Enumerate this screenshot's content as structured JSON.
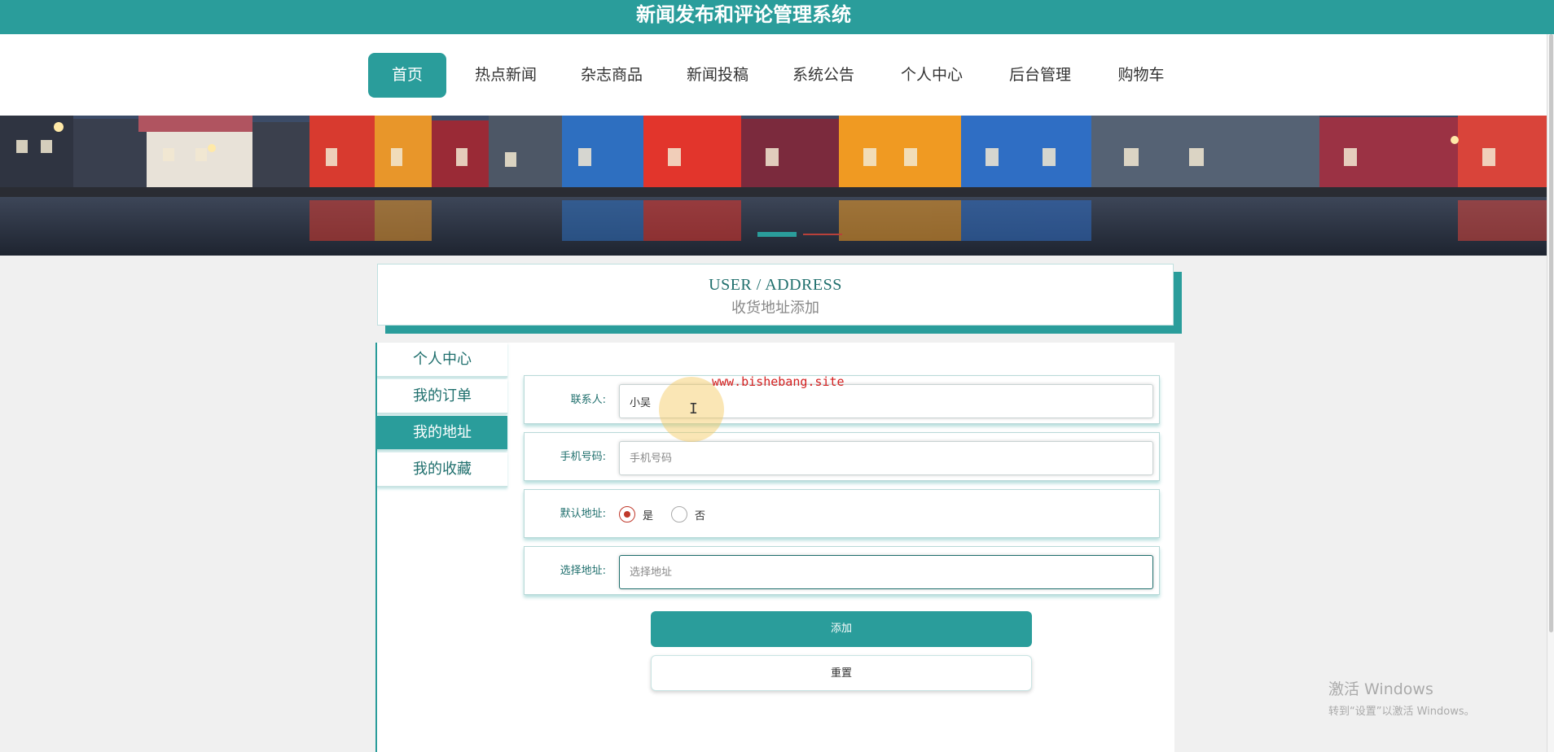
{
  "site": {
    "title": "新闻发布和评论管理系统"
  },
  "nav": {
    "items": [
      {
        "label": "首页"
      },
      {
        "label": "热点新闻"
      },
      {
        "label": "杂志商品"
      },
      {
        "label": "新闻投稿"
      },
      {
        "label": "系统公告"
      },
      {
        "label": "个人中心"
      },
      {
        "label": "后台管理"
      },
      {
        "label": "购物车"
      }
    ],
    "active": "首页"
  },
  "page_header": {
    "title_en": "USER / ADDRESS",
    "title_cn": "收货地址添加"
  },
  "side_menu": {
    "items": [
      {
        "label": "个人中心"
      },
      {
        "label": "我的订单"
      },
      {
        "label": "我的地址"
      },
      {
        "label": "我的收藏"
      }
    ],
    "active": "我的地址"
  },
  "form": {
    "contact": {
      "label": "联系人:",
      "value": "小吴"
    },
    "phone": {
      "label": "手机号码:",
      "placeholder": "手机号码"
    },
    "default": {
      "label": "默认地址:",
      "options": [
        "是",
        "否"
      ],
      "selected": "是"
    },
    "address": {
      "label": "选择地址:",
      "placeholder": "选择地址"
    },
    "add_label": "添加",
    "reset_label": "重置"
  },
  "watermark": {
    "url": "www.bishebang.site"
  },
  "windows_activation": {
    "line1": "激活 Windows",
    "line2": "转到“设置”以激活 Windows。"
  },
  "colors": {
    "primary": "#2a9d9b",
    "radio_checked": "#c0392b",
    "watermark_text": "#d42020"
  }
}
